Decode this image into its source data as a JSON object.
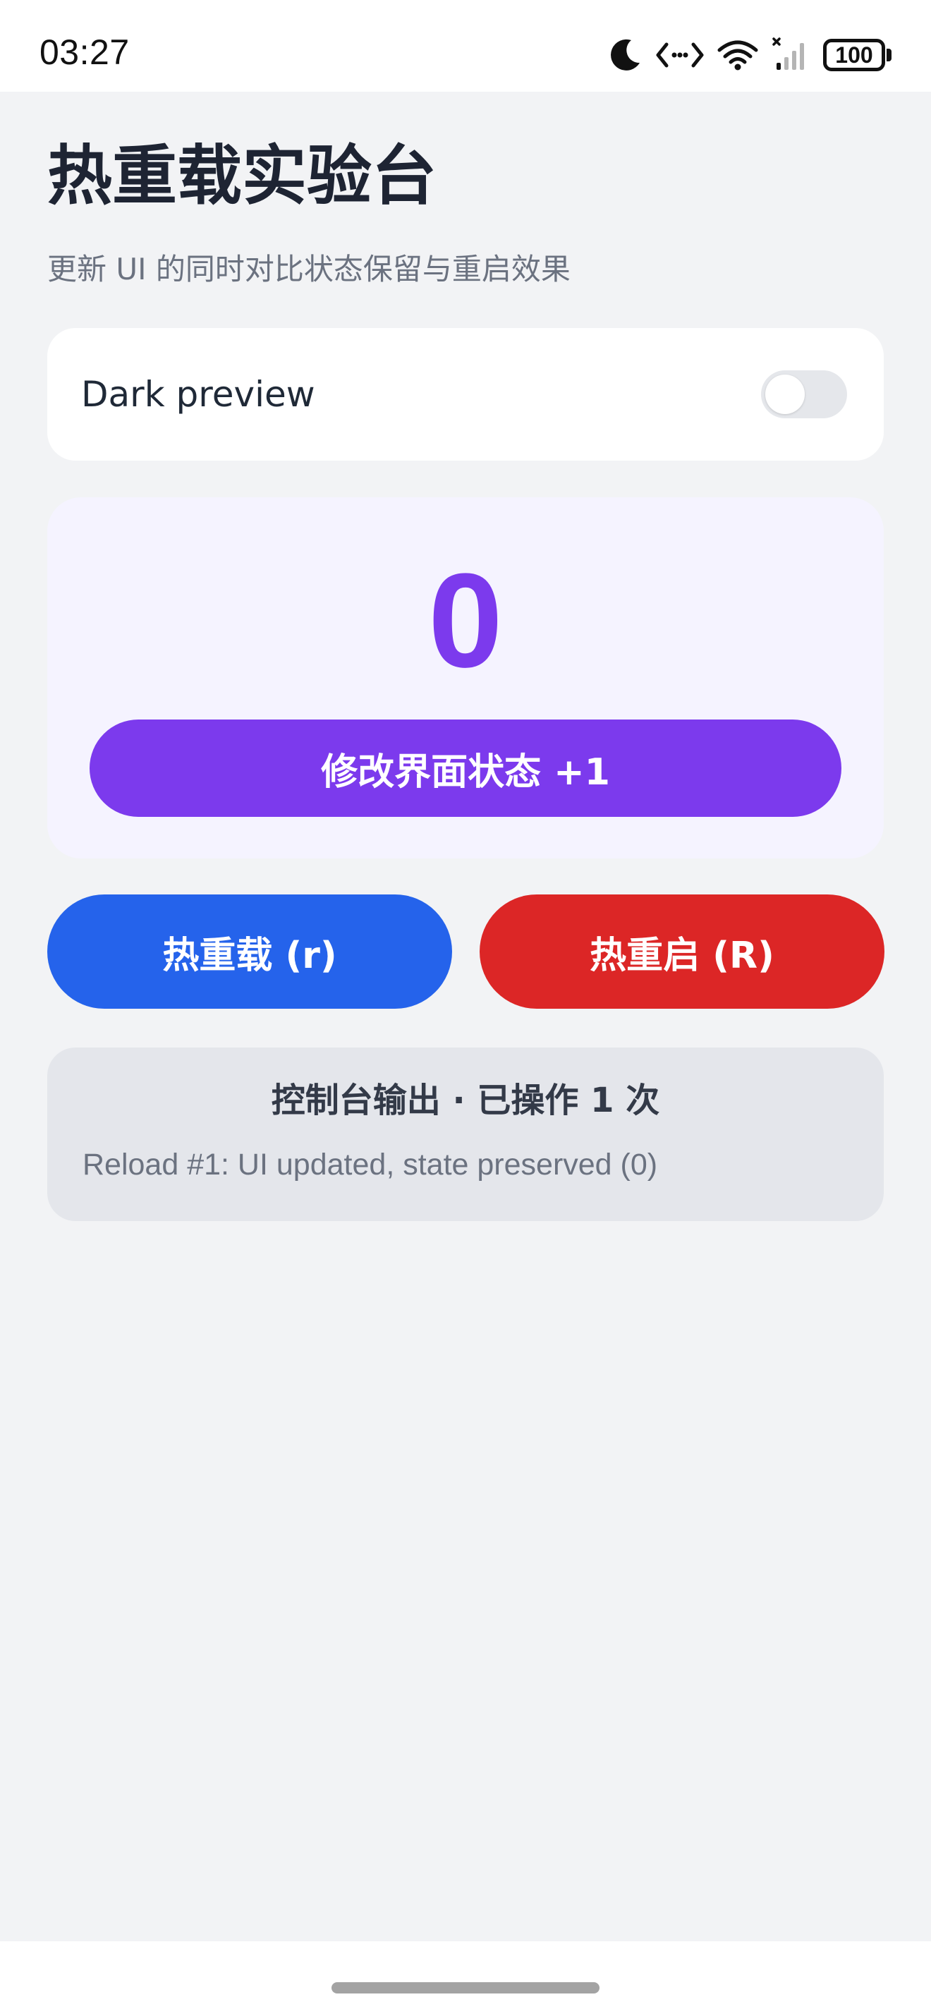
{
  "status_bar": {
    "time": "03:27",
    "battery": "100",
    "icons": [
      "moon-icon",
      "code-arrows-icon",
      "wifi-icon",
      "signal-icon",
      "battery-icon"
    ]
  },
  "header": {
    "title": "热重载实验台",
    "subtitle": "更新 UI 的同时对比状态保留与重启效果"
  },
  "dark_preview": {
    "label": "Dark preview",
    "enabled": false
  },
  "counter": {
    "value": "0",
    "button_label": "修改界面状态 +1"
  },
  "actions": {
    "hot_reload_label": "热重载 (r)",
    "hot_restart_label": "热重启 (R)"
  },
  "console": {
    "title": "控制台输出 · 已操作 1 次",
    "log": "Reload #1: UI updated, state preserved (0)"
  },
  "colors": {
    "accent_purple": "#7c3aed",
    "reload_blue": "#2563eb",
    "restart_red": "#dc2626",
    "background": "#f2f3f5"
  }
}
